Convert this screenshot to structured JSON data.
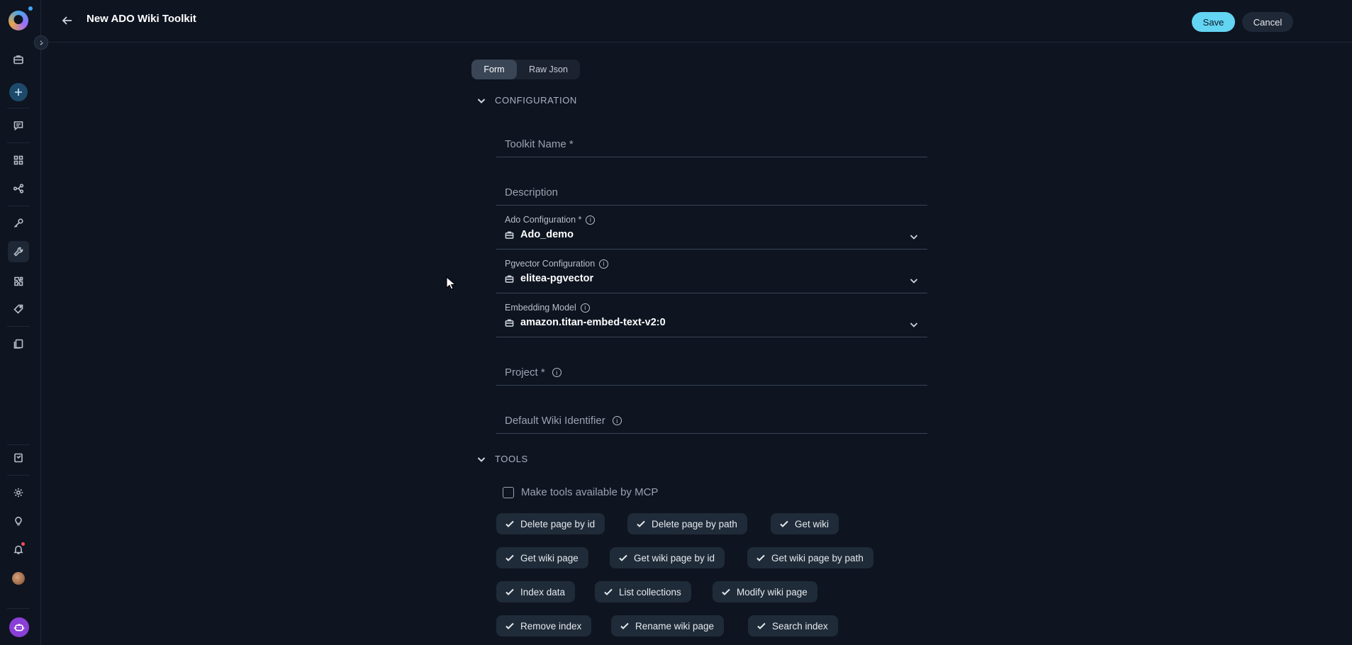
{
  "header": {
    "title": "New ADO Wiki Toolkit",
    "save_label": "Save",
    "cancel_label": "Cancel"
  },
  "tabs": [
    {
      "label": "Form",
      "active": true
    },
    {
      "label": "Raw Json",
      "active": false
    }
  ],
  "configuration": {
    "section_label": "CONFIGURATION",
    "toolkit_name_placeholder": "Toolkit Name *",
    "description_placeholder": "Description",
    "ado_configuration": {
      "label": "Ado Configuration *",
      "value": "Ado_demo"
    },
    "pgvector_configuration": {
      "label": "Pgvector Configuration",
      "value": "elitea-pgvector"
    },
    "embedding_model": {
      "label": "Embedding Model",
      "value": "amazon.titan-embed-text-v2:0"
    },
    "project_placeholder": "Project *",
    "default_wiki_placeholder": "Default Wiki Identifier"
  },
  "tools": {
    "section_label": "TOOLS",
    "mcp_label": "Make tools available by MCP",
    "items": [
      "Delete page by id",
      "Delete page by path",
      "Get wiki",
      "Get wiki page",
      "Get wiki page by id",
      "Get wiki page by path",
      "Index data",
      "List collections",
      "Modify wiki page",
      "Remove index",
      "Rename wiki page",
      "Search index"
    ]
  },
  "colors": {
    "background": "#0e1420",
    "accent": "#63d4f2",
    "chip": "#1f2b38"
  }
}
